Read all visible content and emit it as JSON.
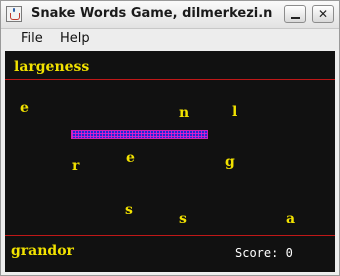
{
  "window": {
    "title": "Snake Words Game, dilmerkezi.n",
    "minimize_label": "",
    "close_label": "✕"
  },
  "menu": {
    "file": "File",
    "help": "Help"
  },
  "game": {
    "target_word": "largeness",
    "current_word": "grandor",
    "score_text": "Score: 0",
    "letters": [
      "e",
      "n",
      "l",
      "r",
      "e",
      "g",
      "s",
      "s",
      "a"
    ],
    "colors": {
      "background": "#111111",
      "text": "#f2e200",
      "divider": "#c01818",
      "snake": "#1d2bd6",
      "snake_accent": "#d21fb8"
    }
  }
}
